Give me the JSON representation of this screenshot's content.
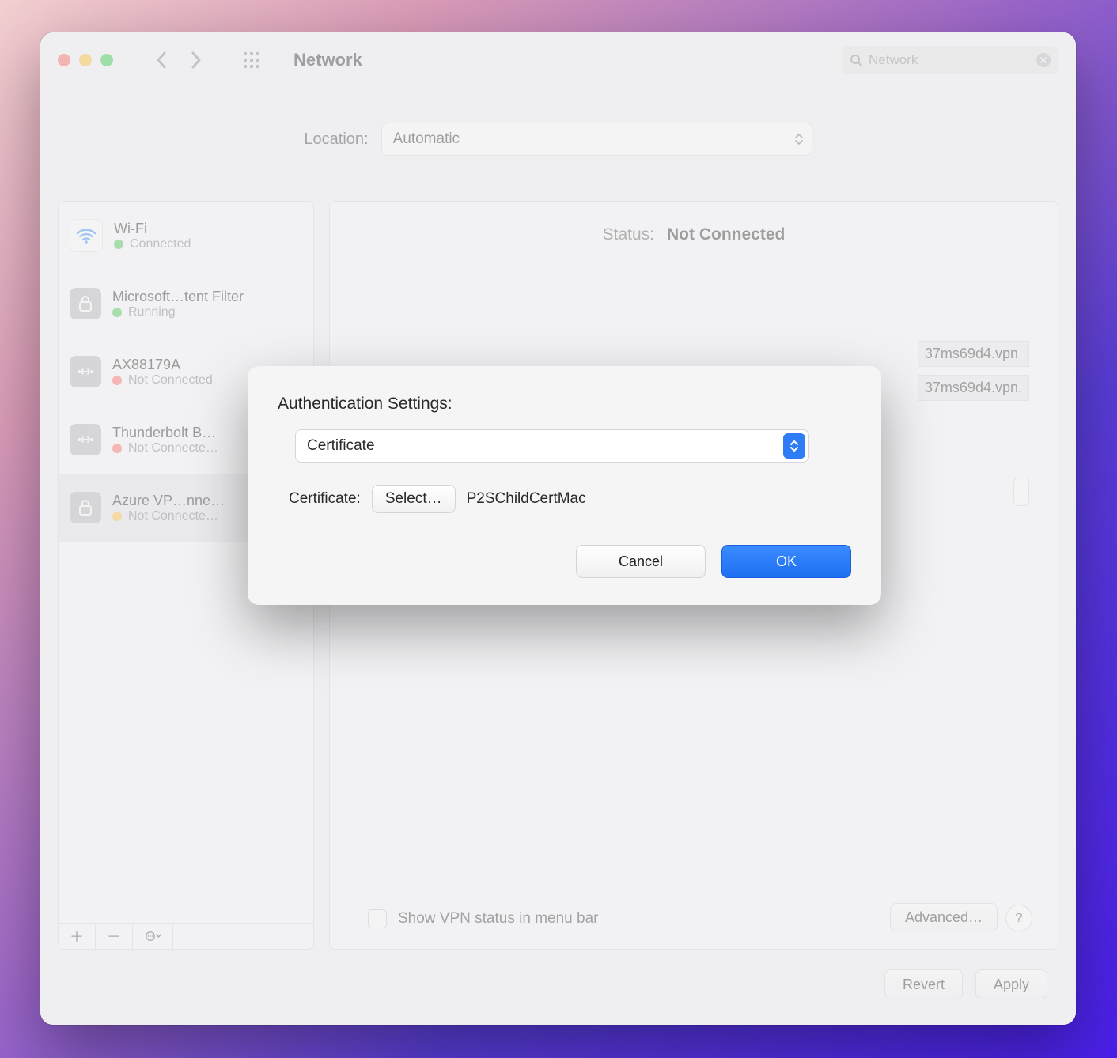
{
  "window": {
    "title": "Network",
    "search_placeholder": "Network"
  },
  "location": {
    "label": "Location:",
    "value": "Automatic"
  },
  "sidebar": {
    "items": [
      {
        "name": "Wi-Fi",
        "status": "Connected",
        "dot": "green",
        "icon": "wifi"
      },
      {
        "name": "Microsoft…tent Filter",
        "status": "Running",
        "dot": "green",
        "icon": "lock"
      },
      {
        "name": "AX88179A",
        "status": "Not Connected",
        "dot": "red",
        "icon": "eth"
      },
      {
        "name": "Thunderbolt B…",
        "status": "Not Connecte…",
        "dot": "red",
        "icon": "eth"
      },
      {
        "name": "Azure VP…nne…",
        "status": "Not Connecte…",
        "dot": "yellow",
        "icon": "lock"
      }
    ]
  },
  "detail": {
    "status_label": "Status:",
    "status_value": "Not Connected",
    "server_lines": [
      "37ms69d4.vpn",
      "37ms69d4.vpn."
    ],
    "show_vpn_label": "Show VPN status in menu bar",
    "advanced_label": "Advanced…",
    "help_label": "?"
  },
  "footer": {
    "revert": "Revert",
    "apply": "Apply"
  },
  "sheet": {
    "title": "Authentication Settings:",
    "method": "Certificate",
    "cert_label": "Certificate:",
    "select_label": "Select…",
    "cert_name": "P2SChildCertMac",
    "cancel": "Cancel",
    "ok": "OK"
  }
}
